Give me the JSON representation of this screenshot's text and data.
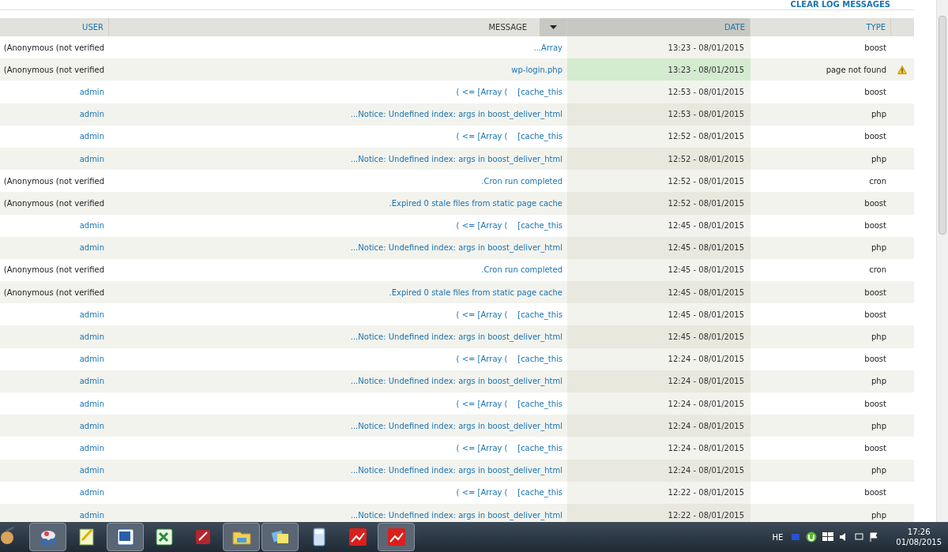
{
  "header_link": {
    "label": "CLEAR LOG MESSAGES"
  },
  "table": {
    "columns": [
      {
        "label": "USER",
        "sorted": false
      },
      {
        "label": "MESSAGE",
        "sorted": false
      },
      {
        "label": "DATE",
        "sorted": true
      },
      {
        "label": "TYPE",
        "sorted": false
      }
    ],
    "rows": [
      {
        "user": "(Anonymous (not verified",
        "user_link": false,
        "message": "...Array",
        "date": "13:23 - 08/01/2015",
        "type": "boost",
        "warning": false
      },
      {
        "user": "(Anonymous (not verified",
        "user_link": false,
        "message": "wp-login.php",
        "date": "13:23 - 08/01/2015",
        "type": "page not found",
        "warning": true
      },
      {
        "user": "admin",
        "user_link": true,
        "message": "( <= [Array (    [cache_this",
        "date": "12:53 - 08/01/2015",
        "type": "boost",
        "warning": false
      },
      {
        "user": "admin",
        "user_link": true,
        "message": "...Notice: Undefined index: args in boost_deliver_html",
        "date": "12:53 - 08/01/2015",
        "type": "php",
        "warning": false
      },
      {
        "user": "admin",
        "user_link": true,
        "message": "( <= [Array (    [cache_this",
        "date": "12:52 - 08/01/2015",
        "type": "boost",
        "warning": false
      },
      {
        "user": "admin",
        "user_link": true,
        "message": "...Notice: Undefined index: args in boost_deliver_html",
        "date": "12:52 - 08/01/2015",
        "type": "php",
        "warning": false
      },
      {
        "user": "(Anonymous (not verified",
        "user_link": false,
        "message": ".Cron run completed",
        "date": "12:52 - 08/01/2015",
        "type": "cron",
        "warning": false
      },
      {
        "user": "(Anonymous (not verified",
        "user_link": false,
        "message": ".Expired 0 stale files from static page cache",
        "date": "12:52 - 08/01/2015",
        "type": "boost",
        "warning": false
      },
      {
        "user": "admin",
        "user_link": true,
        "message": "( <= [Array (    [cache_this",
        "date": "12:45 - 08/01/2015",
        "type": "boost",
        "warning": false
      },
      {
        "user": "admin",
        "user_link": true,
        "message": "...Notice: Undefined index: args in boost_deliver_html",
        "date": "12:45 - 08/01/2015",
        "type": "php",
        "warning": false
      },
      {
        "user": "(Anonymous (not verified",
        "user_link": false,
        "message": ".Cron run completed",
        "date": "12:45 - 08/01/2015",
        "type": "cron",
        "warning": false
      },
      {
        "user": "(Anonymous (not verified",
        "user_link": false,
        "message": ".Expired 0 stale files from static page cache",
        "date": "12:45 - 08/01/2015",
        "type": "boost",
        "warning": false
      },
      {
        "user": "admin",
        "user_link": true,
        "message": "( <= [Array (    [cache_this",
        "date": "12:45 - 08/01/2015",
        "type": "boost",
        "warning": false
      },
      {
        "user": "admin",
        "user_link": true,
        "message": "...Notice: Undefined index: args in boost_deliver_html",
        "date": "12:45 - 08/01/2015",
        "type": "php",
        "warning": false
      },
      {
        "user": "admin",
        "user_link": true,
        "message": "( <= [Array (    [cache_this",
        "date": "12:24 - 08/01/2015",
        "type": "boost",
        "warning": false
      },
      {
        "user": "admin",
        "user_link": true,
        "message": "...Notice: Undefined index: args in boost_deliver_html",
        "date": "12:24 - 08/01/2015",
        "type": "php",
        "warning": false
      },
      {
        "user": "admin",
        "user_link": true,
        "message": "( <= [Array (    [cache_this",
        "date": "12:24 - 08/01/2015",
        "type": "boost",
        "warning": false
      },
      {
        "user": "admin",
        "user_link": true,
        "message": "...Notice: Undefined index: args in boost_deliver_html",
        "date": "12:24 - 08/01/2015",
        "type": "php",
        "warning": false
      },
      {
        "user": "admin",
        "user_link": true,
        "message": "( <= [Array (    [cache_this",
        "date": "12:24 - 08/01/2015",
        "type": "boost",
        "warning": false
      },
      {
        "user": "admin",
        "user_link": true,
        "message": "...Notice: Undefined index: args in boost_deliver_html",
        "date": "12:24 - 08/01/2015",
        "type": "php",
        "warning": false
      },
      {
        "user": "admin",
        "user_link": true,
        "message": "( <= [Array (    [cache_this",
        "date": "12:22 - 08/01/2015",
        "type": "boost",
        "warning": false
      },
      {
        "user": "admin",
        "user_link": true,
        "message": "...Notice: Undefined index: args in boost_deliver_html",
        "date": "12:22 - 08/01/2015",
        "type": "php",
        "warning": false
      }
    ]
  },
  "taskbar": {
    "apps": [
      {
        "kind": "paint",
        "active": false
      },
      {
        "kind": "scissors",
        "active": true
      },
      {
        "kind": "notepad",
        "active": false
      },
      {
        "kind": "word",
        "active": true
      },
      {
        "kind": "excel",
        "active": false
      },
      {
        "kind": "access",
        "active": false
      },
      {
        "kind": "folder",
        "active": true
      },
      {
        "kind": "notes",
        "active": true
      },
      {
        "kind": "calculator",
        "active": false
      },
      {
        "kind": "chart",
        "active": false
      },
      {
        "kind": "chart",
        "active": true
      }
    ],
    "language": "HE",
    "time": "17:26",
    "date": "01/08/2015"
  }
}
